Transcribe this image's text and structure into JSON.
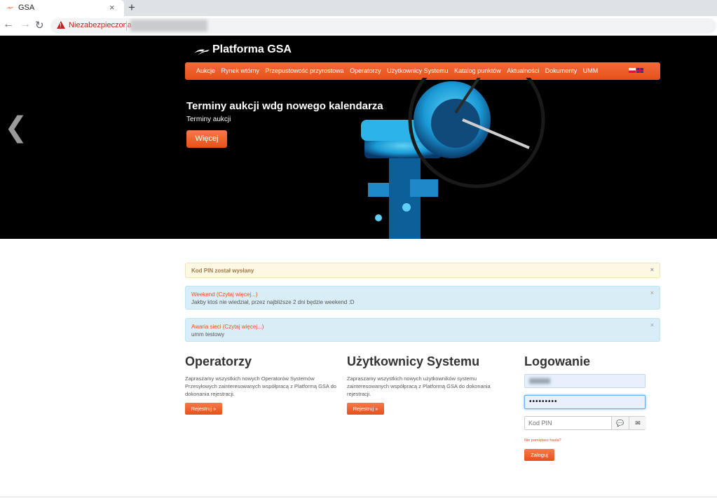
{
  "browser": {
    "tab_title": "GSA",
    "tab_close": "×",
    "new_tab": "+",
    "security_warning": "Niezabezpieczona",
    "back_icon": "←",
    "forward_icon": "→",
    "reload_icon": "↻"
  },
  "site": {
    "logo_text": "Platforma GSA",
    "nav": [
      "Aukcje",
      "Rynek wtórny",
      "Przepustowość przyrostowa",
      "Operatorzy",
      "Użytkownicy Systemu",
      "Katalog punktów",
      "Aktualności",
      "Dokumenty",
      "UMM"
    ]
  },
  "carousel": {
    "prev_arrow": "❮",
    "title": "Terminy aukcji wdg nowego kalendarza",
    "subtitle": "Terminy aukcji",
    "button": "Więcej"
  },
  "alerts": {
    "pin_sent": "Kod PIN został wysłany",
    "close": "×",
    "info1": {
      "link": "Weekend (Czytaj więcej...)",
      "body": "Jakby ktoś nie wiedział, przez najbliższe 2 dni będzie weekend :D"
    },
    "info2": {
      "link": "Awaria sieci (Czytaj więcej...)",
      "body": "umm testowy"
    }
  },
  "operators": {
    "title": "Operatorzy",
    "text": "Zapraszamy wszystkich nowych Operatorów Systemów Przesyłowych zainteresowanych współpracą z Platformą GSA do dokonania rejestracji.",
    "button": "Rejestruj »"
  },
  "users": {
    "title": "Użytkownicy Systemu",
    "text": "Zapraszamy wszystkich nowych użytkowników systemu zainteresowanych współpracą z Platformą GSA do dokonania rejestracji.",
    "button": "Rejestruj »"
  },
  "login": {
    "title": "Logowanie",
    "password": "•••••••••",
    "pin_placeholder": "Kod PIN",
    "sms_icon": "💬",
    "mail_icon": "✉",
    "forgot": "Nie pamiętasz hasła?",
    "button": "Zaloguj"
  },
  "colors": {
    "accent": "#e8501a",
    "info_bg": "#d9edf7",
    "warning_bg": "#fcf8e3"
  }
}
